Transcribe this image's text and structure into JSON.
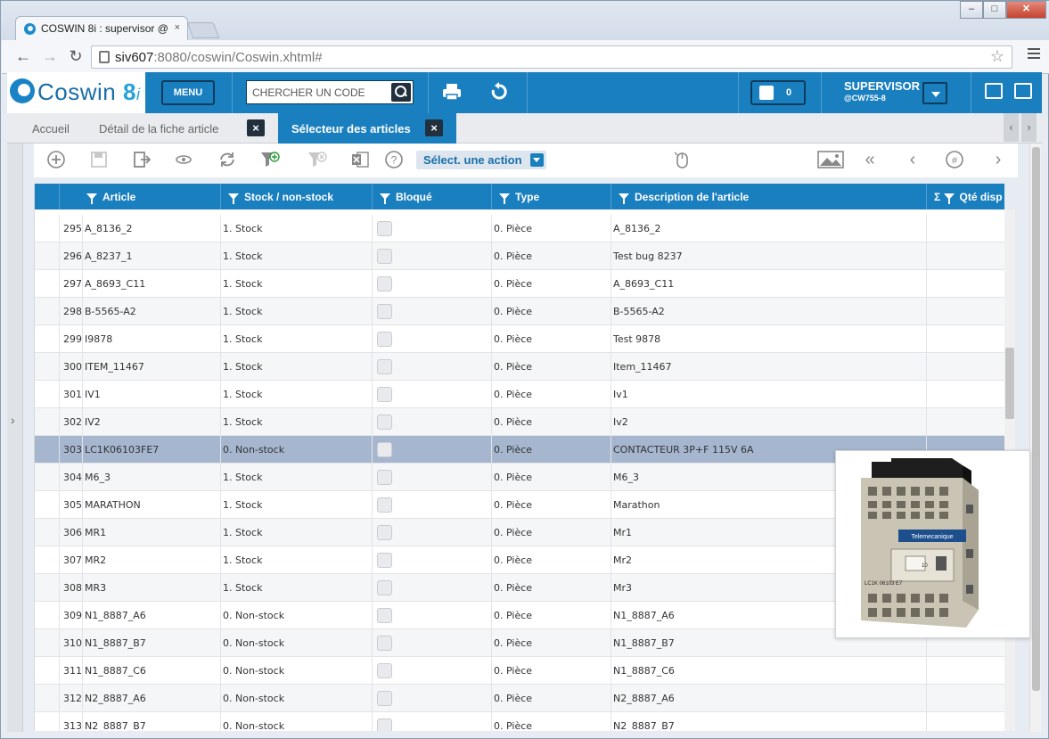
{
  "browser": {
    "tab_title": "COSWIN 8i : supervisor @",
    "tab_close": "×",
    "url_host": "siv607",
    "url_rest": ":8080/coswin/Coswin.xhtml#",
    "window_buttons": [
      "–",
      "□",
      "✕"
    ]
  },
  "header": {
    "logo_text": "Coswin",
    "logo_version": "8",
    "logo_suffix": "i",
    "menu_label": "MENU",
    "search_placeholder": "CHERCHER UN CODE",
    "notif_count": "0",
    "user_name": "SUPERVISOR",
    "user_sub": "@CW755-8",
    "accent": "#1a7fbf"
  },
  "tabs": [
    {
      "label": "Accueil",
      "closable": false
    },
    {
      "label": "Détail de la fiche article",
      "closable": true
    },
    {
      "label": "Sélecteur des articles",
      "closable": true,
      "active": true
    }
  ],
  "tab_close_glyph": "×",
  "toolbar": {
    "action_label": "Sélect. une action",
    "icons": [
      "add-icon",
      "save-icon",
      "export-icon",
      "view-icon",
      "refresh-icon",
      "filter-add-icon",
      "filter-clear-icon",
      "excel-icon",
      "help-icon",
      "mouse-icon",
      "image-icon",
      "first-page-icon",
      "prev-page-icon",
      "page-number-icon",
      "next-page-icon"
    ]
  },
  "grid": {
    "columns": [
      "Article",
      "Stock / non-stock",
      "Bloqué",
      "Type",
      "Description de l'article",
      "Qté disp"
    ],
    "sum_glyph": "Σ",
    "selected_row_index": 8,
    "rows": [
      {
        "num": "295",
        "article": "A_8136_2",
        "stock": "1. Stock",
        "type": "0. Pièce",
        "desc": "A_8136_2"
      },
      {
        "num": "296",
        "article": "A_8237_1",
        "stock": "1. Stock",
        "type": "0. Pièce",
        "desc": "Test bug 8237"
      },
      {
        "num": "297",
        "article": "A_8693_C11",
        "stock": "1. Stock",
        "type": "0. Pièce",
        "desc": "A_8693_C11"
      },
      {
        "num": "298",
        "article": "B-5565-A2",
        "stock": "1. Stock",
        "type": "0. Pièce",
        "desc": "B-5565-A2"
      },
      {
        "num": "299",
        "article": "I9878",
        "stock": "1. Stock",
        "type": "0. Pièce",
        "desc": "Test 9878"
      },
      {
        "num": "300",
        "article": "ITEM_11467",
        "stock": "1. Stock",
        "type": "0. Pièce",
        "desc": "Item_11467"
      },
      {
        "num": "301",
        "article": "IV1",
        "stock": "1. Stock",
        "type": "0. Pièce",
        "desc": "Iv1"
      },
      {
        "num": "302",
        "article": "IV2",
        "stock": "1. Stock",
        "type": "0. Pièce",
        "desc": "Iv2"
      },
      {
        "num": "303",
        "article": "LC1K06103FE7",
        "stock": "0. Non-stock",
        "type": "0. Pièce",
        "desc": "CONTACTEUR 3P+F 115V 6A"
      },
      {
        "num": "304",
        "article": "M6_3",
        "stock": "1. Stock",
        "type": "0. Pièce",
        "desc": "M6_3"
      },
      {
        "num": "305",
        "article": "MARATHON",
        "stock": "1. Stock",
        "type": "0. Pièce",
        "desc": "Marathon"
      },
      {
        "num": "306",
        "article": "MR1",
        "stock": "1. Stock",
        "type": "0. Pièce",
        "desc": "Mr1"
      },
      {
        "num": "307",
        "article": "MR2",
        "stock": "1. Stock",
        "type": "0. Pièce",
        "desc": "Mr2"
      },
      {
        "num": "308",
        "article": "MR3",
        "stock": "1. Stock",
        "type": "0. Pièce",
        "desc": "Mr3"
      },
      {
        "num": "309",
        "article": "N1_8887_A6",
        "stock": "0. Non-stock",
        "type": "0. Pièce",
        "desc": "N1_8887_A6"
      },
      {
        "num": "310",
        "article": "N1_8887_B7",
        "stock": "0. Non-stock",
        "type": "0. Pièce",
        "desc": "N1_8887_B7"
      },
      {
        "num": "311",
        "article": "N1_8887_C6",
        "stock": "0. Non-stock",
        "type": "0. Pièce",
        "desc": "N1_8887_C6"
      },
      {
        "num": "312",
        "article": "N2_8887_A6",
        "stock": "0. Non-stock",
        "type": "0. Pièce",
        "desc": "N2_8887_A6"
      },
      {
        "num": "313",
        "article": "N2_8887_B7",
        "stock": "0. Non-stock",
        "type": "0. Pièce",
        "desc": "N2_8887_B7"
      }
    ]
  },
  "preview": {
    "image_semantic": "contactor-product-photo",
    "brand_label": "Telemecanique",
    "model_label": "LC1K 06103 E7"
  }
}
